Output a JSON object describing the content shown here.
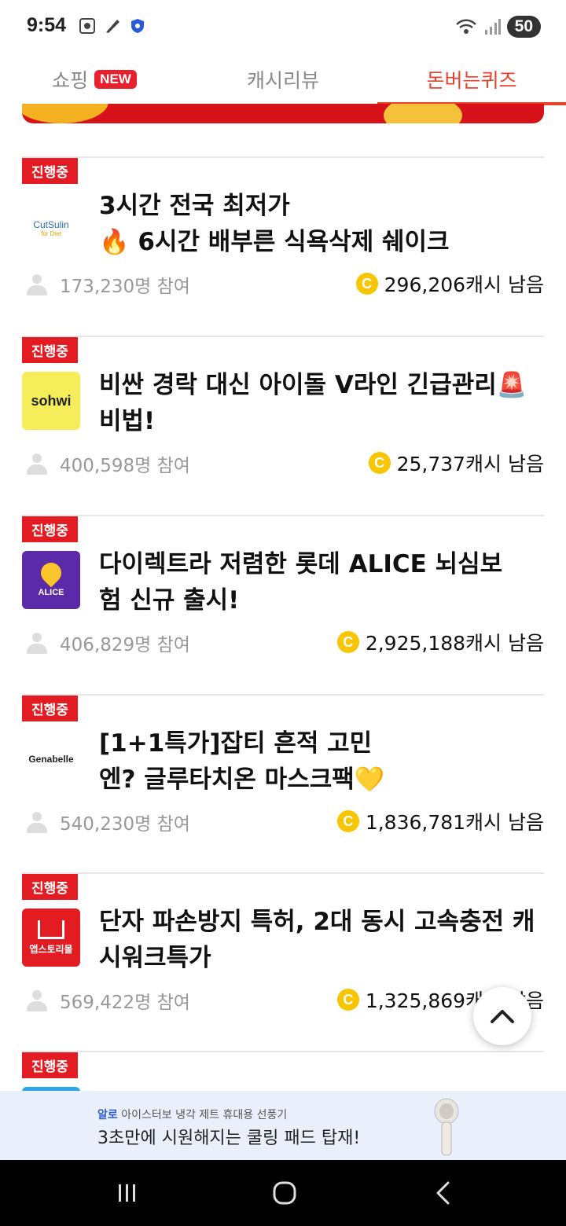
{
  "status_bar": {
    "time": "9:54",
    "battery": "50"
  },
  "tabs": [
    {
      "label": "쇼핑",
      "badge": "NEW"
    },
    {
      "label": "캐시리뷰"
    },
    {
      "label": "돈버는퀴즈"
    }
  ],
  "items": [
    {
      "status": "진행중",
      "logo": "CutSulin",
      "logo_sub": "for Diet",
      "title_line1": "3시간 전국 최저가",
      "title_line2": "🔥 6시간 배부른 식욕삭제 쉐이크",
      "participants": "173,230명 참여",
      "remaining": "296,206캐시 남음"
    },
    {
      "status": "진행중",
      "logo": "sohwi",
      "title_line1": "비싼 경락 대신 아이돌 V라인 긴급관리🚨",
      "title_line2": "비법!",
      "participants": "400,598명 참여",
      "remaining": "25,737캐시 남음"
    },
    {
      "status": "진행중",
      "logo": "ALICE",
      "title_line1": "다이렉트라 저렴한 롯데 ALICE 뇌심보",
      "title_line2": "험 신규 출시!",
      "participants": "406,829명 참여",
      "remaining": "2,925,188캐시 남음"
    },
    {
      "status": "진행중",
      "logo": "Genabelle",
      "title_line1": "[1+1특가]잡티 흔적 고민",
      "title_line2": "엔? 글루타치온 마스크팩💛",
      "participants": "540,230명 참여",
      "remaining": "1,836,781캐시 남음"
    },
    {
      "status": "진행중",
      "logo": "앱스토리몰",
      "title_line1": "단자 파손방지 특허, 2대 동시 고속충전 캐",
      "title_line2": "시워크특가",
      "participants": "569,422명 참여",
      "remaining": "1,325,869캐시 남음"
    },
    {
      "status": "진행중"
    }
  ],
  "coin_symbol": "C",
  "ad": {
    "brand": "알로",
    "line1": "아이스터보 냉각 제트 휴대용 선풍기",
    "line2": "3초만에 시원해지는 쿨링 패드 탑재!"
  },
  "colors": {
    "accent": "#e8412c",
    "badge": "#e31c23",
    "coin": "#f7c600"
  }
}
